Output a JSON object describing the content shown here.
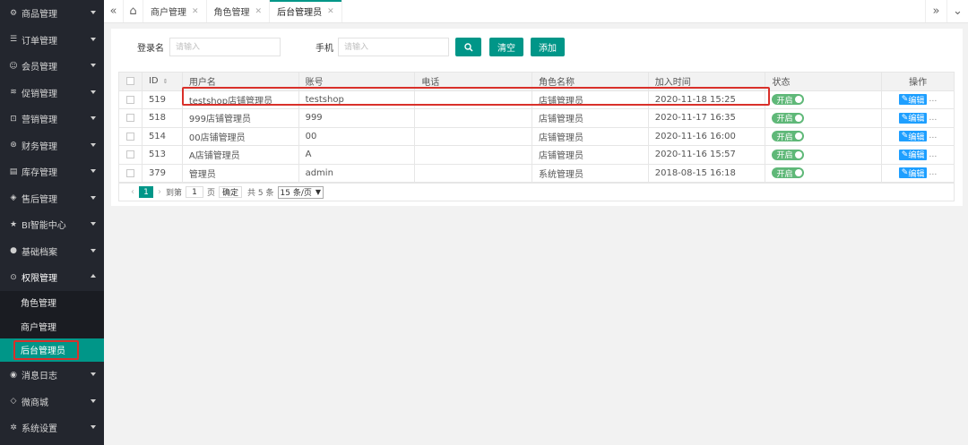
{
  "sidebar": {
    "items_top": [
      {
        "label": "商品管理",
        "icon": "gear-circle-icon"
      },
      {
        "label": "订单管理",
        "icon": "list-icon"
      },
      {
        "label": "会员管理",
        "icon": "user-icon"
      },
      {
        "label": "促销管理",
        "icon": "stack-icon"
      },
      {
        "label": "营销管理",
        "icon": "cart-icon"
      },
      {
        "label": "财务管理",
        "icon": "money-icon"
      },
      {
        "label": "库存管理",
        "icon": "warehouse-icon"
      },
      {
        "label": "售后管理",
        "icon": "shield-icon"
      },
      {
        "label": "BI智能中心",
        "icon": "star-icon"
      },
      {
        "label": "基础档案",
        "icon": "circle-icon"
      },
      {
        "label": "权限管理",
        "icon": "shield-check-icon"
      }
    ],
    "sub_items": [
      {
        "label": "角色管理"
      },
      {
        "label": "商户管理"
      },
      {
        "label": "后台管理员"
      }
    ],
    "items_bottom": [
      {
        "label": "消息日志",
        "icon": "eye-icon"
      },
      {
        "label": "微商城",
        "icon": "diamond-icon"
      },
      {
        "label": "系统设置",
        "icon": "gear-icon"
      }
    ]
  },
  "tabs": [
    {
      "label": "商户管理"
    },
    {
      "label": "角色管理"
    },
    {
      "label": "后台管理员"
    }
  ],
  "search": {
    "login_label": "登录名",
    "login_placeholder": "请输入",
    "phone_label": "手机",
    "phone_placeholder": "请输入",
    "clear_label": "清空",
    "add_label": "添加"
  },
  "table": {
    "headers": [
      "ID",
      "用户名",
      "账号",
      "电话",
      "角色名称",
      "加入时间",
      "状态",
      "操作"
    ],
    "rows": [
      {
        "id": "519",
        "name": "testshop店铺管理员",
        "account": "testshop",
        "phone": "",
        "role": "店铺管理员",
        "time": "2020-11-18 15:25",
        "status": "开启",
        "action": "编辑"
      },
      {
        "id": "518",
        "name": "999店铺管理员",
        "account": "999",
        "phone": "",
        "role": "店铺管理员",
        "time": "2020-11-17 16:35",
        "status": "开启",
        "action": "编辑"
      },
      {
        "id": "514",
        "name": "00店铺管理员",
        "account": "00",
        "phone": "",
        "role": "店铺管理员",
        "time": "2020-11-16 16:00",
        "status": "开启",
        "action": "编辑"
      },
      {
        "id": "513",
        "name": "A店铺管理员",
        "account": "A",
        "phone": "",
        "role": "店铺管理员",
        "time": "2020-11-16 15:57",
        "status": "开启",
        "action": "编辑"
      },
      {
        "id": "379",
        "name": "管理员",
        "account": "admin",
        "phone": "",
        "role": "系统管理员",
        "time": "2018-08-15 16:18",
        "status": "开启",
        "action": "编辑"
      }
    ]
  },
  "pager": {
    "current": "1",
    "goto_prefix": "到第",
    "goto_value": "1",
    "goto_suffix": "页",
    "confirm": "确定",
    "total": "共 5 条",
    "page_size": "15 条/页"
  },
  "colors": {
    "accent": "#009688",
    "sidebar_bg": "#23262e",
    "highlight": "#d9302a",
    "switch_on": "#5fb878",
    "edit": "#1e9fff"
  }
}
